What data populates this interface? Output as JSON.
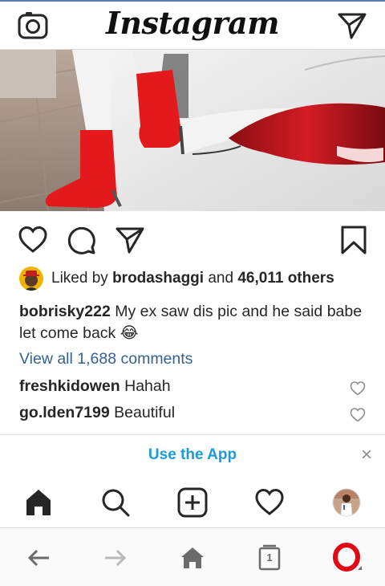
{
  "app": {
    "title": "Instagram"
  },
  "likes": {
    "prefix": "Liked by",
    "user": "brodashaggi",
    "joiner": "and",
    "others": "46,011 others"
  },
  "caption": {
    "user": "bobrisky222",
    "text": "My ex saw dis pic and he said babe let come back",
    "emoji": "😂"
  },
  "view_all": "View all 1,688 comments",
  "comments": [
    {
      "user": "freshkidowen",
      "text": "Hahah"
    },
    {
      "user": "go.lden7199",
      "text": "Beautiful"
    }
  ],
  "banner": {
    "label": "Use the App",
    "close": "×"
  },
  "browser": {
    "tabs_count": "1"
  },
  "colors": {
    "link": "#34618f",
    "banner_text": "#1d9bd9",
    "boot_red": "#e3191b",
    "opera_red": "#e30613"
  }
}
